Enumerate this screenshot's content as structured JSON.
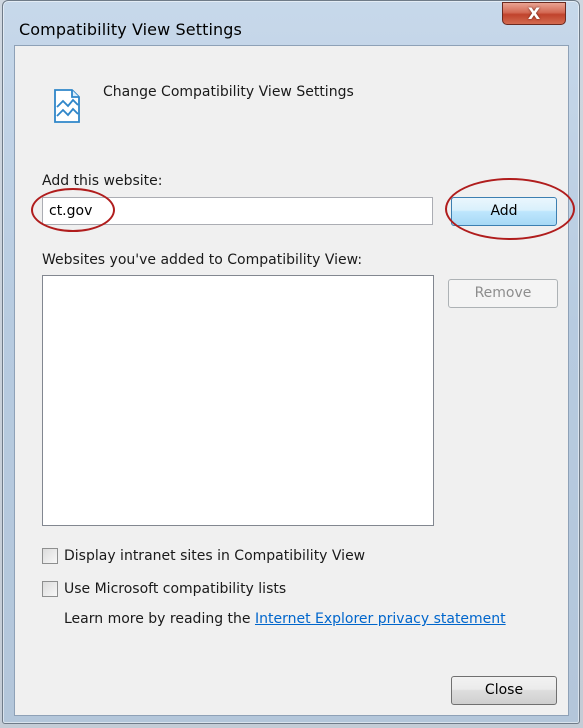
{
  "window": {
    "title": "Compatibility View Settings",
    "close_glyph": "X"
  },
  "header": {
    "icon": "compatibility-view-icon",
    "title": "Change Compatibility View Settings"
  },
  "add_section": {
    "label": "Add this website:",
    "input_value": "ct.gov",
    "add_button_label": "Add"
  },
  "list_section": {
    "label": "Websites you've added to Compatibility View:",
    "items": [],
    "remove_button_label": "Remove"
  },
  "options": {
    "intranet_label": "Display intranet sites in Compatibility View",
    "intranet_checked": false,
    "ms_lists_label": "Use Microsoft compatibility lists",
    "ms_lists_checked": false
  },
  "footer": {
    "learn_more_prefix": "Learn more by reading the ",
    "privacy_link_text": "Internet Explorer privacy statement",
    "close_button_label": "Close"
  },
  "colors": {
    "annotation_red": "#b01d1d",
    "link_blue": "#0066cc",
    "close_red": "#c0432c"
  }
}
